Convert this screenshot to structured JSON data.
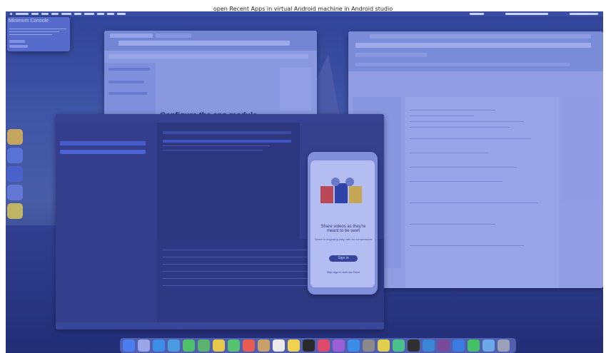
{
  "caption": "open Recent Apps in virtual Android machine in Android studio",
  "minimal_console": {
    "title": "Minimum Console"
  },
  "docs_page": {
    "heading": "Configure the app module"
  },
  "emulator": {
    "title": "Share videos as they're meant to be seen",
    "body": "Share in original quality, with no compression",
    "button": "Sign in",
    "skip": "Skip sign in and use Drive"
  },
  "colors": {
    "overlay": "#465ac8",
    "dock": "#7887dc"
  },
  "icons": {
    "dock": [
      "finder-icon",
      "launchpad-icon",
      "safari-icon",
      "mail-icon",
      "messages-icon",
      "maps-icon",
      "photos-icon",
      "facetime-icon",
      "calendar-icon",
      "contacts-icon",
      "reminders-icon",
      "notes-icon",
      "tv-icon",
      "music-icon",
      "podcasts-icon",
      "appstore-icon",
      "settings-icon",
      "chrome-icon",
      "android-studio-icon",
      "terminal-icon",
      "vscode-icon",
      "slack-icon",
      "zoom-icon",
      "spotify-icon",
      "folder-icon",
      "trash-icon"
    ]
  }
}
